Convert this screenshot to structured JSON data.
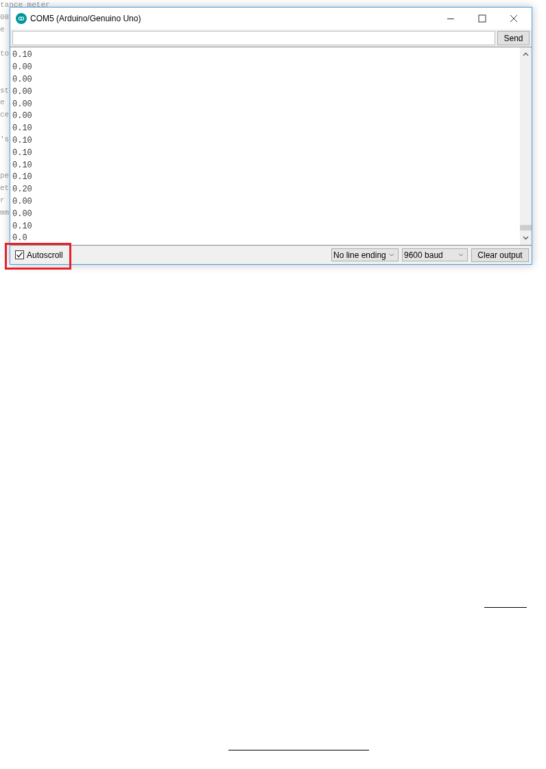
{
  "background_code": [
    "tance meter",
    "08",
    "e",
    "to",
    "st",
    "e",
    "ce",
    "'s",
    "pe",
    "et",
    "r",
    "mm"
  ],
  "window": {
    "title": "COM5 (Arduino/Genuino Uno)"
  },
  "send_button": "Send",
  "output_lines": [
    "0.10",
    "0.00",
    "0.00",
    "0.00",
    "0.00",
    "0.00",
    "0.10",
    "0.10",
    "0.10",
    "0.10",
    "0.10",
    "0.20",
    "0.00",
    "0.00",
    "0.10",
    "0.0"
  ],
  "autoscroll": {
    "label": "Autoscroll",
    "checked": true,
    "highlighted": true
  },
  "line_ending": "No line ending",
  "baud_rate": "9600 baud",
  "clear_button": "Clear output"
}
